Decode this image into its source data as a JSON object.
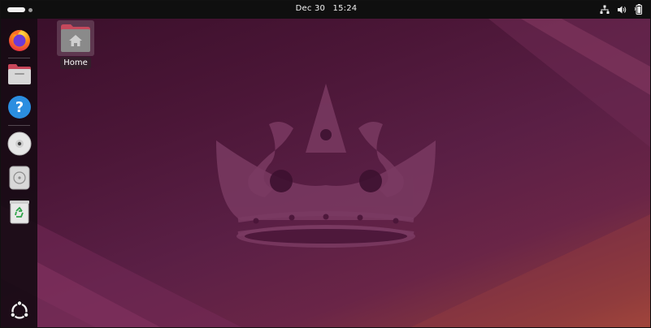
{
  "top_bar": {
    "date": "Dec 30",
    "time": "15:24",
    "tray_icons": [
      "network-icon",
      "volume-icon",
      "battery-icon"
    ]
  },
  "dock": {
    "items": [
      {
        "name": "Firefox",
        "icon": "firefox-icon"
      },
      {
        "name": "Files",
        "icon": "files-icon"
      },
      {
        "name": "Help",
        "icon": "help-icon"
      },
      {
        "name": "Disc",
        "icon": "cd-icon"
      },
      {
        "name": "Disk",
        "icon": "disk-icon"
      },
      {
        "name": "Trash",
        "icon": "trash-icon"
      }
    ],
    "apps_icon": "ubuntu-logo-icon"
  },
  "desktop": {
    "icons": [
      {
        "label": "Home",
        "icon": "home-folder-icon"
      }
    ]
  },
  "colors": {
    "panel": "#0f0f0f",
    "dock": "#140a12",
    "accent": "#e95420",
    "wallpaper_dark": "#3a0f2a",
    "wallpaper_light": "#a5493a"
  }
}
